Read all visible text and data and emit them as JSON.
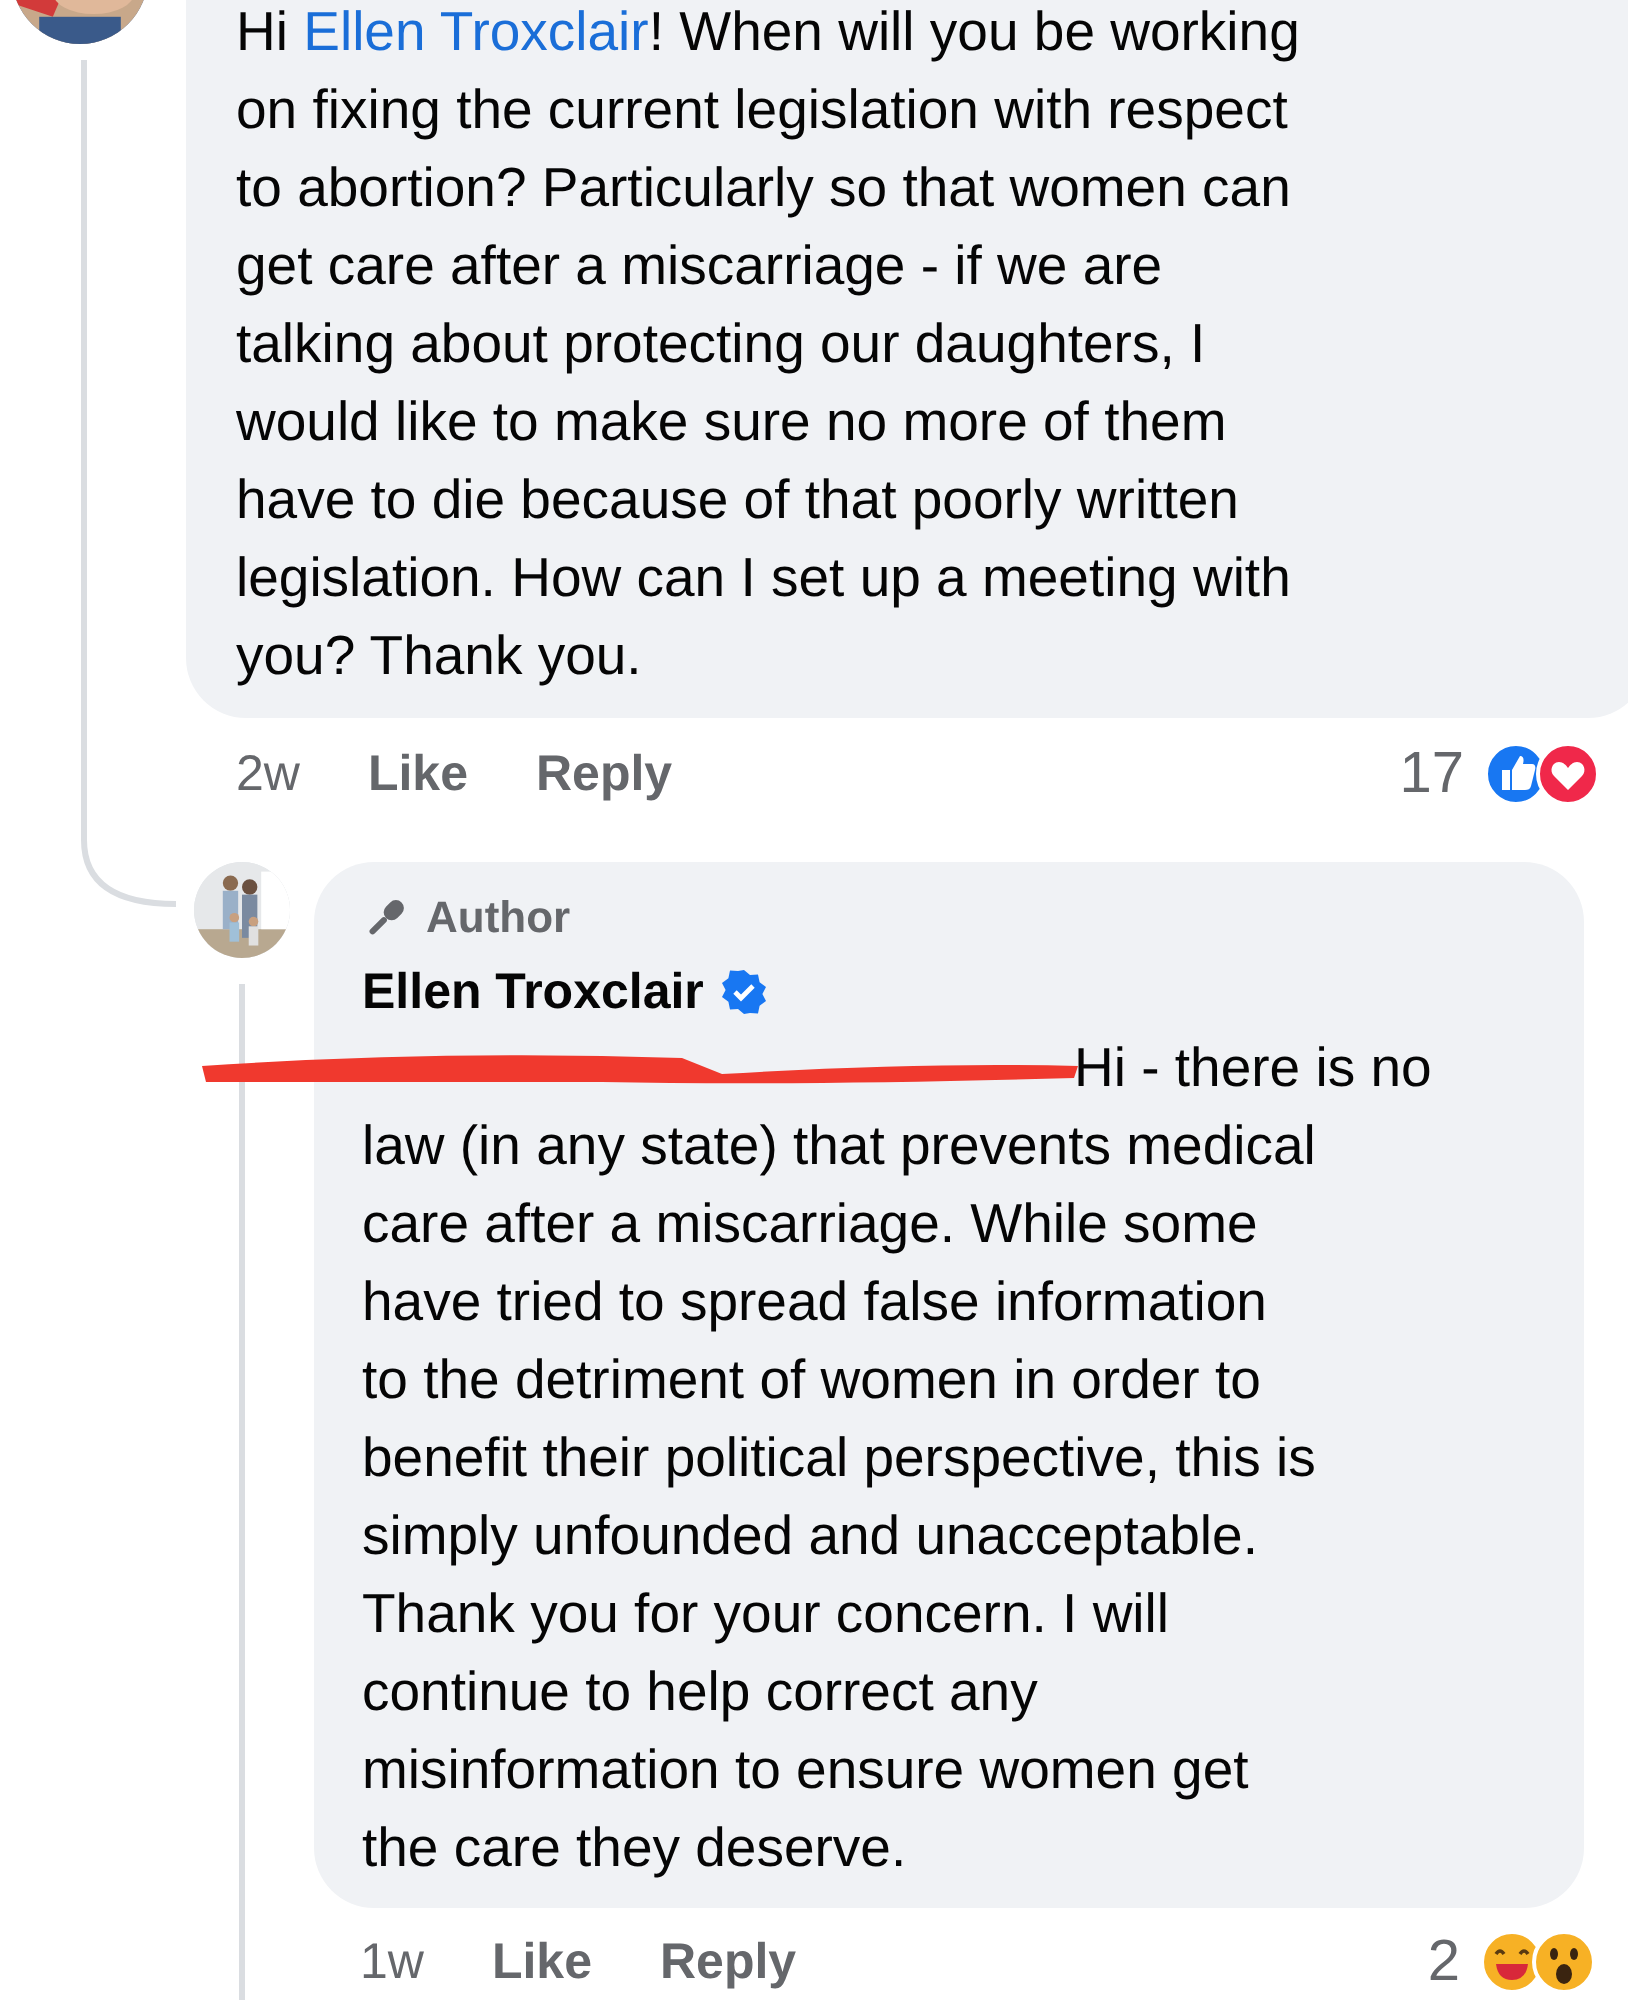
{
  "comment": {
    "mention_prefix": "Hi ",
    "mention": "Ellen Troxclair",
    "lines": [
      "! When will you be working",
      "on fixing the current legislation with respect",
      "to abortion? Particularly so that women can",
      "get care after a miscarriage - if we are",
      "talking about protecting our daughters, I",
      "would like to make sure no more of them",
      "have to die because of that poorly written",
      "legislation. How can I set up a meeting with",
      "you? Thank you."
    ],
    "footer": {
      "time": "2w",
      "like": "Like",
      "reply": "Reply",
      "count": "17",
      "reactions": [
        {
          "kind": "like"
        },
        {
          "kind": "love"
        }
      ]
    }
  },
  "reply": {
    "badge": "Author",
    "name": "Ellen Troxclair",
    "verified": true,
    "redacted_mention": true,
    "lines": [
      "Hi - there is no",
      "law (in any state) that prevents medical",
      "care after a miscarriage. While some",
      "have tried to spread false information",
      "to the detriment of women in order to",
      "benefit their political perspective, this is",
      "simply unfounded and unacceptable.",
      "Thank you for your concern. I will",
      "continue to help correct any",
      "misinformation to ensure women get",
      "the care they deserve."
    ],
    "footer": {
      "time": "1w",
      "like": "Like",
      "reply": "Reply",
      "count": "2",
      "reactions": [
        {
          "kind": "haha"
        },
        {
          "kind": "wow"
        }
      ]
    }
  }
}
